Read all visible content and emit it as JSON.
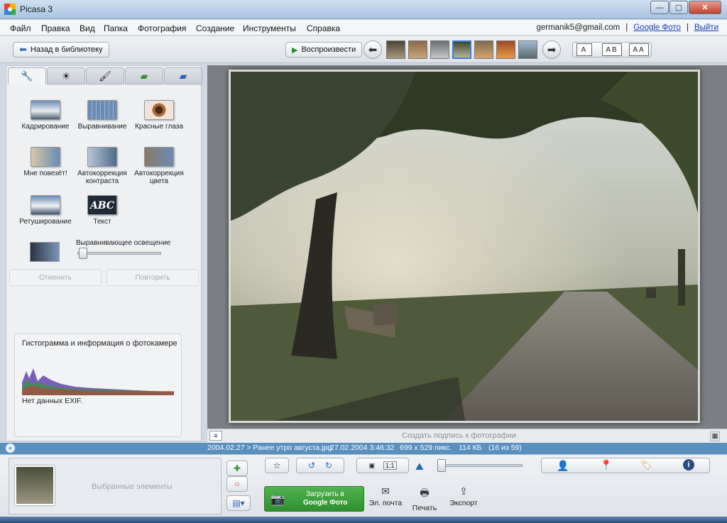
{
  "window": {
    "title": "Picasa 3",
    "min": "—",
    "max": "▢",
    "close": "✕"
  },
  "menu": [
    "Файл",
    "Правка",
    "Вид",
    "Папка",
    "Фотография",
    "Создание",
    "Инструменты",
    "Справка"
  ],
  "account": {
    "email": "germanik5@gmail.com",
    "google_photos": "Google Фото",
    "logout": "Выйти",
    "sep": "|"
  },
  "toolbar": {
    "back_label": "Назад в библиотеку",
    "play_label": "Воспроизвести",
    "font_small": "A",
    "font_mid": "AB",
    "font_large": "AA"
  },
  "tools": [
    {
      "label": "Кадрирование"
    },
    {
      "label": "Выравнивание"
    },
    {
      "label": "Красные глаза"
    },
    {
      "label": "Мне повезёт!"
    },
    {
      "label": "Автокоррекция контраста"
    },
    {
      "label": "Автокоррекция цвета"
    },
    {
      "label": "Ретуширование"
    },
    {
      "label": "Текст"
    }
  ],
  "fill_light": {
    "label": "Выравнивающее освещение",
    "value": 0.02
  },
  "buttons": {
    "undo": "Отменить",
    "redo": "Повторить"
  },
  "histogram": {
    "title": "Гистограмма и информация о фотокамере",
    "exif": "Нет данных EXIF."
  },
  "caption": {
    "placeholder": "Создать подпись к фотографии"
  },
  "info": {
    "path": "2004.02.27 > Ранее утро августа.jpg",
    "date": "27.02.2004 3:46:32",
    "size": "699 x 529 пикс.",
    "filesize": "114 КБ",
    "count": "(16 из 59)"
  },
  "tray": {
    "selected": "Выбранные элементы",
    "upload_line1": "Загрузить в",
    "upload_line2": "Google Фото",
    "email": "Эл. почта",
    "print": "Печать",
    "export": "Экспорт"
  },
  "icons": {
    "back": "arrow-left-icon",
    "play": "play-icon",
    "prev": "prev-icon",
    "next": "next-icon",
    "wrench": "wrench-icon",
    "star": "star-icon",
    "camera": "camera-icon",
    "person": "person-icon",
    "pin": "map-pin-icon",
    "tag": "tag-icon",
    "info": "info-icon"
  },
  "colors": {
    "accent": "#2f8f2f",
    "infostrip": "#5a8fbe"
  }
}
